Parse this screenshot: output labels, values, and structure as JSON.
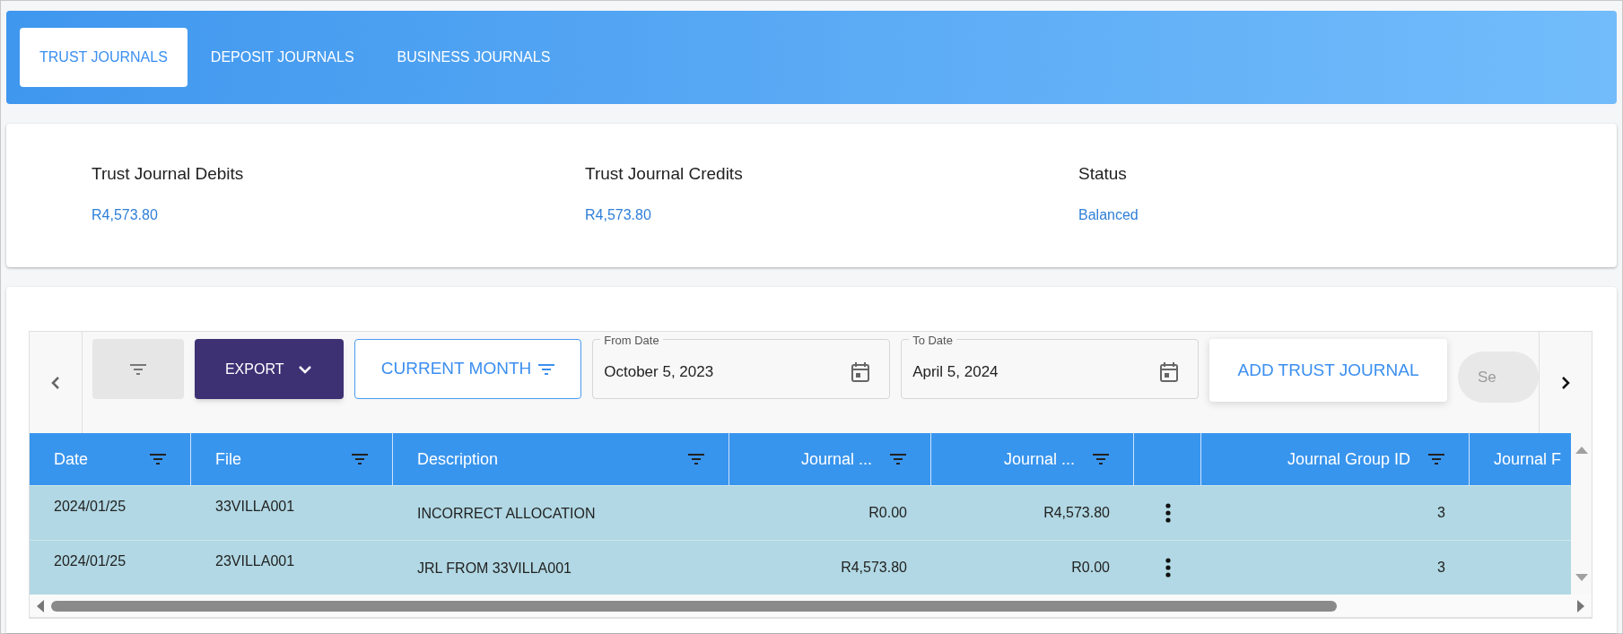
{
  "tabs": [
    {
      "label": "TRUST JOURNALS",
      "selected": true
    },
    {
      "label": "DEPOSIT JOURNALS",
      "selected": false
    },
    {
      "label": "BUSINESS JOURNALS",
      "selected": false
    }
  ],
  "summary": [
    {
      "label": "Trust Journal Debits",
      "value": "R4,573.80"
    },
    {
      "label": "Trust Journal Credits",
      "value": "R4,573.80"
    },
    {
      "label": "Status",
      "value": "Balanced"
    }
  ],
  "toolbar": {
    "export": "EXPORT",
    "period": "CURRENT MONTH",
    "from_date": {
      "label": "From Date",
      "value": "October 5, 2023"
    },
    "to_date": {
      "label": "To Date",
      "value": "April 5, 2024"
    },
    "add": "ADD TRUST JOURNAL",
    "cut_button": "Se"
  },
  "table": {
    "columns": [
      {
        "label": "Date",
        "kind": "text",
        "filter": true
      },
      {
        "label": "File",
        "kind": "text",
        "filter": true
      },
      {
        "label": "Description",
        "kind": "text",
        "filter": true
      },
      {
        "label": "Journal ...",
        "kind": "amount",
        "filter": true
      },
      {
        "label": "Journal ...",
        "kind": "amount",
        "filter": true
      },
      {
        "kind": "menu",
        "filter": false
      },
      {
        "label": "Journal Group ID",
        "kind": "amount",
        "filter": true
      },
      {
        "label": "Journal F",
        "kind": "text",
        "filter": false
      }
    ],
    "rows": [
      {
        "cells": [
          "2024/01/25",
          "33VILLA001",
          "INCORRECT ALLOCATION",
          "R0.00",
          "R4,573.80",
          "3"
        ]
      },
      {
        "cells": [
          "2024/01/25",
          "23VILLA001",
          "JRL FROM 33VILLA001",
          "R4,573.80",
          "R0.00",
          "3"
        ]
      }
    ]
  }
}
